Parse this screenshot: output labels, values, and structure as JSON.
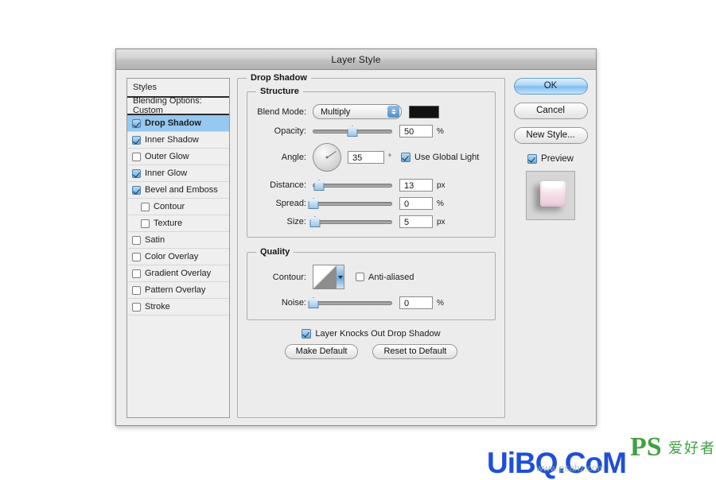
{
  "window": {
    "title": "Layer Style"
  },
  "styles_panel": {
    "header": "Styles",
    "blending_options": "Blending Options: Custom",
    "items": [
      {
        "label": "Drop Shadow",
        "checked": true,
        "selected": true,
        "sub": false
      },
      {
        "label": "Inner Shadow",
        "checked": true,
        "selected": false,
        "sub": false
      },
      {
        "label": "Outer Glow",
        "checked": false,
        "selected": false,
        "sub": false
      },
      {
        "label": "Inner Glow",
        "checked": true,
        "selected": false,
        "sub": false
      },
      {
        "label": "Bevel and Emboss",
        "checked": true,
        "selected": false,
        "sub": false
      },
      {
        "label": "Contour",
        "checked": false,
        "selected": false,
        "sub": true
      },
      {
        "label": "Texture",
        "checked": false,
        "selected": false,
        "sub": true
      },
      {
        "label": "Satin",
        "checked": false,
        "selected": false,
        "sub": false
      },
      {
        "label": "Color Overlay",
        "checked": false,
        "selected": false,
        "sub": false
      },
      {
        "label": "Gradient Overlay",
        "checked": false,
        "selected": false,
        "sub": false
      },
      {
        "label": "Pattern Overlay",
        "checked": false,
        "selected": false,
        "sub": false
      },
      {
        "label": "Stroke",
        "checked": false,
        "selected": false,
        "sub": false
      }
    ]
  },
  "drop_shadow": {
    "title": "Drop Shadow",
    "structure": {
      "title": "Structure",
      "blend_mode_label": "Blend Mode:",
      "blend_mode_value": "Multiply",
      "shadow_color": "#111111",
      "opacity_label": "Opacity:",
      "opacity_value": "50",
      "opacity_unit": "%",
      "opacity_pct": 50,
      "angle_label": "Angle:",
      "angle_value": "35",
      "angle_unit": "°",
      "use_global_light": "Use Global Light",
      "use_global_light_checked": true,
      "distance_label": "Distance:",
      "distance_value": "13",
      "distance_unit": "px",
      "distance_pct": 8,
      "spread_label": "Spread:",
      "spread_value": "0",
      "spread_unit": "%",
      "spread_pct": 0,
      "size_label": "Size:",
      "size_value": "5",
      "size_unit": "px",
      "size_pct": 3
    },
    "quality": {
      "title": "Quality",
      "contour_label": "Contour:",
      "anti_aliased": "Anti-aliased",
      "anti_aliased_checked": false,
      "noise_label": "Noise:",
      "noise_value": "0",
      "noise_unit": "%",
      "noise_pct": 0
    },
    "knockout_label": "Layer Knocks Out Drop Shadow",
    "knockout_checked": true,
    "make_default": "Make Default",
    "reset_to_default": "Reset to Default"
  },
  "actions": {
    "ok": "OK",
    "cancel": "Cancel",
    "new_style": "New Style...",
    "preview_label": "Preview",
    "preview_checked": true
  },
  "watermark": {
    "main": "UiBQ.CoM",
    "logo": "PS",
    "chinese": "爱好者",
    "sub": "www.psahz.com"
  },
  "colors": {
    "accent_blue": "#96c8f0",
    "button_blue": "#7fbdee",
    "dialog_bg": "#ececec",
    "watermark_blue": "#1f4fd8",
    "watermark_green": "#3fa03f"
  }
}
